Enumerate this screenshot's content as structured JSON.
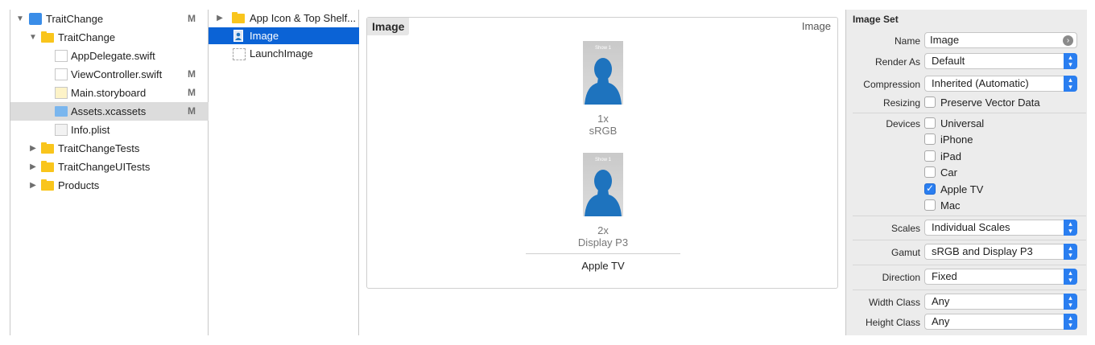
{
  "navigator": {
    "items": [
      {
        "label": "TraitChange",
        "status": "M"
      },
      {
        "label": "TraitChange",
        "status": ""
      },
      {
        "label": "AppDelegate.swift",
        "status": ""
      },
      {
        "label": "ViewController.swift",
        "status": "M"
      },
      {
        "label": "Main.storyboard",
        "status": "M"
      },
      {
        "label": "Assets.xcassets",
        "status": "M"
      },
      {
        "label": "Info.plist",
        "status": ""
      },
      {
        "label": "TraitChangeTests",
        "status": ""
      },
      {
        "label": "TraitChangeUITests",
        "status": ""
      },
      {
        "label": "Products",
        "status": ""
      }
    ]
  },
  "asset_list": {
    "items": [
      {
        "label": "App Icon & Top Shelf..."
      },
      {
        "label": "Image"
      },
      {
        "label": "LaunchImage"
      }
    ]
  },
  "editor": {
    "set_name": "Image",
    "set_kind": "Image",
    "slot_placeholder": "Show 1",
    "slots": [
      {
        "scale": "1x",
        "gamut": "sRGB"
      },
      {
        "scale": "2x",
        "gamut": "Display P3"
      }
    ],
    "device_name": "Apple TV"
  },
  "inspector": {
    "header": "Image Set",
    "name_label": "Name",
    "name_value": "Image",
    "render_as_label": "Render As",
    "render_as_value": "Default",
    "compression_label": "Compression",
    "compression_value": "Inherited (Automatic)",
    "resizing_label": "Resizing",
    "resizing_option": {
      "label": "Preserve Vector Data",
      "checked": false
    },
    "devices_label": "Devices",
    "devices": [
      {
        "label": "Universal",
        "checked": false
      },
      {
        "label": "iPhone",
        "checked": false
      },
      {
        "label": "iPad",
        "checked": false
      },
      {
        "label": "Car",
        "checked": false
      },
      {
        "label": "Apple TV",
        "checked": true
      },
      {
        "label": "Mac",
        "checked": false
      }
    ],
    "scales_label": "Scales",
    "scales_value": "Individual Scales",
    "gamut_label": "Gamut",
    "gamut_value": "sRGB and Display P3",
    "direction_label": "Direction",
    "direction_value": "Fixed",
    "width_class_label": "Width Class",
    "width_class_value": "Any",
    "height_class_label": "Height Class",
    "height_class_value": "Any"
  },
  "colors": {
    "selection_blue": "#0b63d6",
    "folder_yellow": "#f9c51c",
    "silhouette_blue": "#1e73be",
    "popup_blue": "#2a7ef0"
  }
}
